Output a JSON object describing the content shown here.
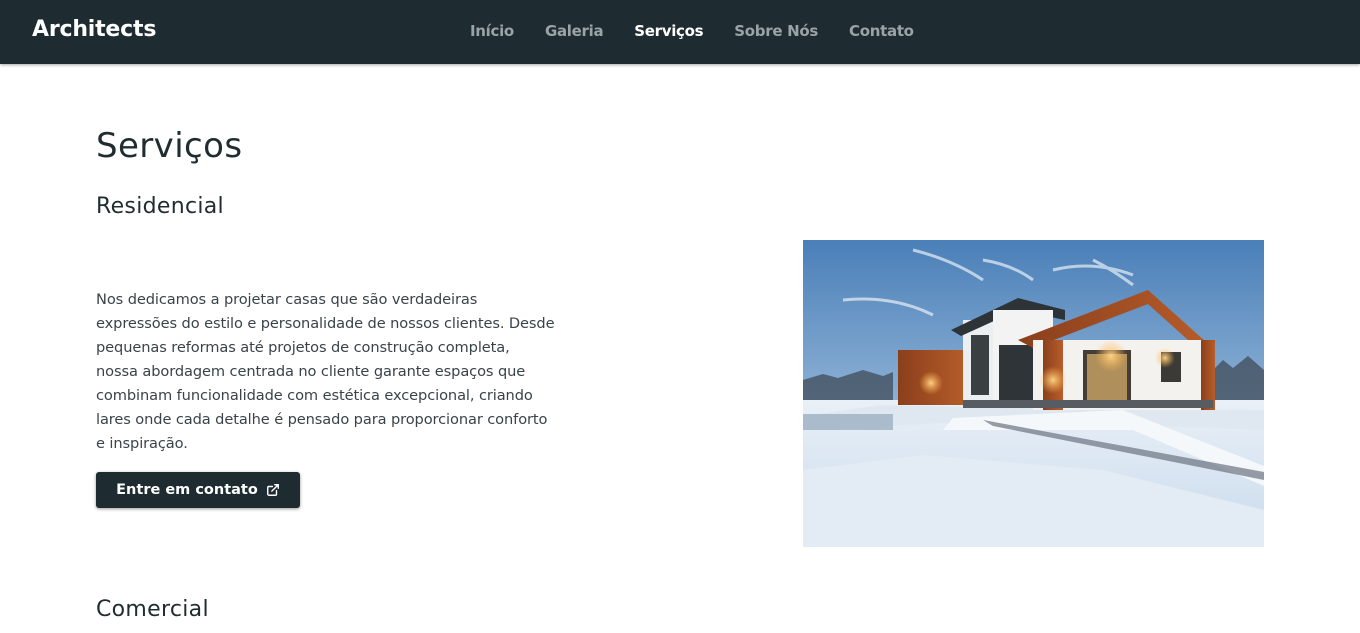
{
  "navbar": {
    "brand": "Architects",
    "links": [
      {
        "label": "Início",
        "active": false
      },
      {
        "label": "Galeria",
        "active": false
      },
      {
        "label": "Serviços",
        "active": true
      },
      {
        "label": "Sobre Nós",
        "active": false
      },
      {
        "label": "Contato",
        "active": false
      }
    ],
    "background_color": "#1e2c31",
    "active_color": "#ffffff",
    "inactive_color": "#9aa3a6"
  },
  "main": {
    "page_title": "Serviços",
    "sections": [
      {
        "title": "Residencial",
        "description": "Nos dedicamos a projetar casas que são verdadeiras expressões do estilo e personalidade de nossos clientes. Desde pequenas reformas até projetos de construção completa, nossa abordagem centrada no cliente garante espaços que combinam funcionalidade com estética excepcional, criando lares onde cada detalhe é pensado para proporcionar conforto e inspiração.",
        "button_label": "Entre em contato",
        "button_icon": "external-link-icon",
        "image": "modern-house-in-snow"
      },
      {
        "title": "Comercial"
      }
    ]
  }
}
